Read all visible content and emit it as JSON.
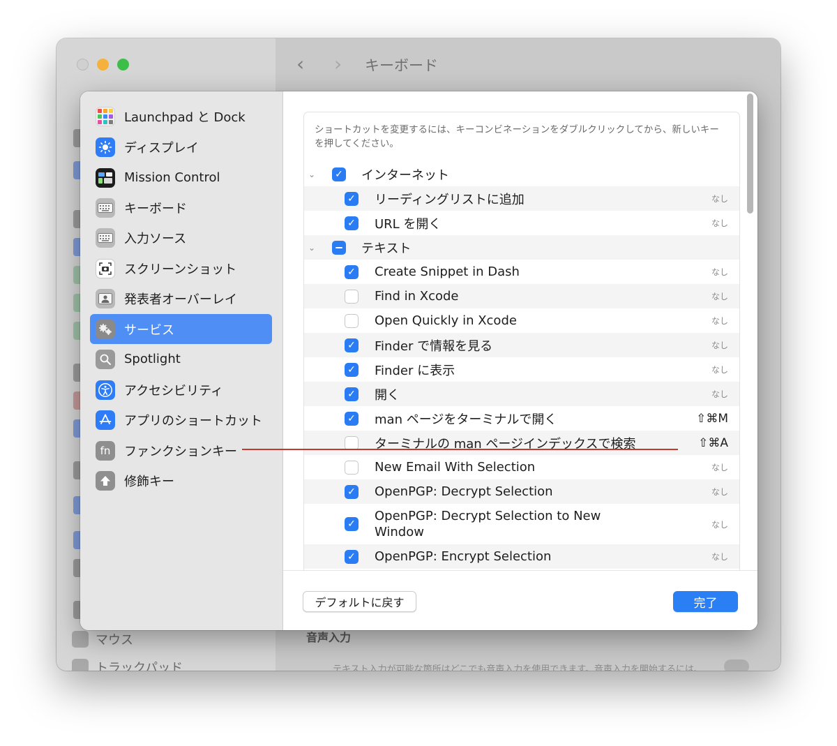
{
  "background_window": {
    "title": "キーボード",
    "nav_back": "‹",
    "nav_forward": "›",
    "sidebar_partial": [
      "マウス",
      "トラックパッド"
    ],
    "section_title": "音声入力",
    "section_desc": "テキスト入力が可能な箇所はどこでも音声入力を使用できます。音声入力を開始するには、"
  },
  "sidebar": {
    "items": [
      {
        "label": "Launchpad と Dock",
        "icon": "launchpad-icon"
      },
      {
        "label": "ディスプレイ",
        "icon": "display-icon"
      },
      {
        "label": "Mission Control",
        "icon": "mission-control-icon"
      },
      {
        "label": "キーボード",
        "icon": "keyboard-icon"
      },
      {
        "label": "入力ソース",
        "icon": "input-source-icon"
      },
      {
        "label": "スクリーンショット",
        "icon": "screenshot-icon"
      },
      {
        "label": "発表者オーバーレイ",
        "icon": "presenter-overlay-icon"
      },
      {
        "label": "サービス",
        "icon": "services-icon",
        "selected": true
      },
      {
        "label": "Spotlight",
        "icon": "spotlight-icon"
      },
      {
        "label": "アクセシビリティ",
        "icon": "accessibility-icon"
      },
      {
        "label": "アプリのショートカット",
        "icon": "app-shortcuts-icon"
      },
      {
        "label": "ファンクションキー",
        "icon": "function-keys-icon"
      },
      {
        "label": "修飾キー",
        "icon": "modifier-keys-icon"
      }
    ],
    "fn_glyph": "fn"
  },
  "panel": {
    "description": "ショートカットを変更するには、キーコンビネーションをダブルクリックしてから、新しいキーを押してください。",
    "rows": [
      {
        "type": "group",
        "label": "インターネット",
        "state": "on",
        "chevron": "⌄",
        "shortcut": ""
      },
      {
        "type": "item",
        "label": "リーディングリストに追加",
        "state": "on",
        "shortcut": "なし"
      },
      {
        "type": "item",
        "label": "URL を開く",
        "state": "on",
        "shortcut": "なし"
      },
      {
        "type": "group",
        "label": "テキスト",
        "state": "mixed",
        "chevron": "⌄",
        "shortcut": ""
      },
      {
        "type": "item",
        "label": "Create Snippet in Dash",
        "state": "on",
        "shortcut": "なし"
      },
      {
        "type": "item",
        "label": "Find in Xcode",
        "state": "off",
        "shortcut": "なし"
      },
      {
        "type": "item",
        "label": "Open Quickly in Xcode",
        "state": "off",
        "shortcut": "なし"
      },
      {
        "type": "item",
        "label": "Finder で情報を見る",
        "state": "on",
        "shortcut": "なし"
      },
      {
        "type": "item",
        "label": "Finder に表示",
        "state": "on",
        "shortcut": "なし"
      },
      {
        "type": "item",
        "label": "開く",
        "state": "on",
        "shortcut": "なし"
      },
      {
        "type": "item",
        "label": "man ページをターミナルで開く",
        "state": "on",
        "shortcut": "⇧⌘M"
      },
      {
        "type": "item",
        "label": "ターミナルの man ページインデックスで検索",
        "state": "off",
        "shortcut": "⇧⌘A"
      },
      {
        "type": "item",
        "label": "New Email With Selection",
        "state": "off",
        "shortcut": "なし"
      },
      {
        "type": "item",
        "label": "OpenPGP: Decrypt Selection",
        "state": "on",
        "shortcut": "なし"
      },
      {
        "type": "item",
        "label": "OpenPGP: Decrypt Selection to New Window",
        "state": "on",
        "shortcut": "なし",
        "tall": true
      },
      {
        "type": "item",
        "label": "OpenPGP: Encrypt Selection",
        "state": "on",
        "shortcut": "なし"
      }
    ],
    "checkmark_glyph": "✓",
    "restore_defaults": "デフォルトに戻す",
    "done": "完了"
  },
  "colors": {
    "accent": "#2a7cf4",
    "selected_sidebar": "#4e8ef5",
    "annotation_line": "#c7382b"
  }
}
